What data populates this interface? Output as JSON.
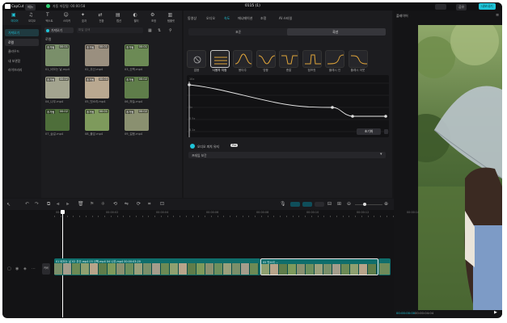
{
  "app": {
    "name": "CapCut",
    "menu": "메뉴",
    "autosave": "자동 저장됨: 00:00:58",
    "project_title": "0115 (1)",
    "window_btn_1": "",
    "window_btn_2": "",
    "export": "내보내기",
    "share": "공유"
  },
  "toolbar": {
    "items": [
      {
        "label": "미디어",
        "icon": "media-icon"
      },
      {
        "label": "오디오",
        "icon": "audio-icon"
      },
      {
        "label": "텍스트",
        "icon": "text-icon"
      },
      {
        "label": "스티커",
        "icon": "sticker-icon"
      },
      {
        "label": "효과",
        "icon": "effects-icon"
      },
      {
        "label": "전환",
        "icon": "transition-icon"
      },
      {
        "label": "캡션",
        "icon": "caption-icon"
      },
      {
        "label": "필터",
        "icon": "filter-icon"
      },
      {
        "label": "조정",
        "icon": "adjust-icon"
      },
      {
        "label": "템플릿",
        "icon": "template-icon"
      }
    ]
  },
  "sidebar": {
    "items": [
      "가져오기",
      "로컬",
      "클라우드",
      "내 보관함",
      "라이브러리"
    ],
    "selected_index": 1
  },
  "media": {
    "import_label": "가져오기",
    "search_placeholder": "파일 검색",
    "section": "로컬",
    "clips": [
      {
        "tag": "추가됨",
        "dur": "00:01",
        "name": "01_비오는 날.mp4"
      },
      {
        "tag": "추가됨",
        "dur": "00:01",
        "name": "02_우산.mp4"
      },
      {
        "tag": "추가됨",
        "dur": "00:01",
        "name": "03_산책.mp4"
      },
      {
        "tag": "추가됨",
        "dur": "00:02",
        "name": "04_나무.mp4"
      },
      {
        "tag": "추가됨",
        "dur": "00:03",
        "name": "05_빗소리.mp4"
      },
      {
        "tag": "추가됨",
        "dur": "00:02",
        "name": "06_하늘.mp4"
      },
      {
        "tag": "추가됨",
        "dur": "00:02",
        "name": "07_숲길.mp4"
      },
      {
        "tag": "추가됨",
        "dur": "00:01",
        "name": "08_풀잎.mp4"
      },
      {
        "tag": "추가됨",
        "dur": "00:02",
        "name": "09_걸음.mp4"
      }
    ]
  },
  "speed_panel": {
    "tabs": [
      "동영상",
      "오디오",
      "속도",
      "애니메이션",
      "조정",
      "AI 스타일"
    ],
    "active_tab": 2,
    "sub_tabs": [
      "표준",
      "곡선"
    ],
    "active_sub": 1,
    "curves": [
      "없음",
      "사용자 지정",
      "몽타주",
      "영웅",
      "총알",
      "점프컷",
      "플래시 인",
      "플래시 아웃"
    ],
    "selected_curve": 1,
    "y_top": "10x",
    "y_mid": "1x",
    "y_low": "0.5x",
    "y_bottom": "0.1x",
    "reset_label": "초기화",
    "pitch_toggle": "오디오 피치 유지",
    "pitch_badge": "Pro",
    "dropdown": "프레임 보간",
    "duration_label": "",
    "duration_value": ""
  },
  "player": {
    "title": "플레이어",
    "time_current": "00:00:00:00",
    "time_total": "00:00:04:04"
  },
  "timeline": {
    "ruler": [
      "00:00",
      "00:00:02",
      "00:00:04",
      "00:00:06",
      "00:00:08",
      "00:00:10",
      "00:00:12",
      "00:00:14"
    ],
    "track_label": "커버",
    "clip_labels": "01 비오는 날   02 우산.mp4   03 산책.mp4   04 나무.mp4   00:00:03:20",
    "clip2_label": "05 빗소리 ..."
  },
  "colors": {
    "accent": "#1fc4d8",
    "clip_teal": "#0f6e6c",
    "bg": "#161618"
  }
}
